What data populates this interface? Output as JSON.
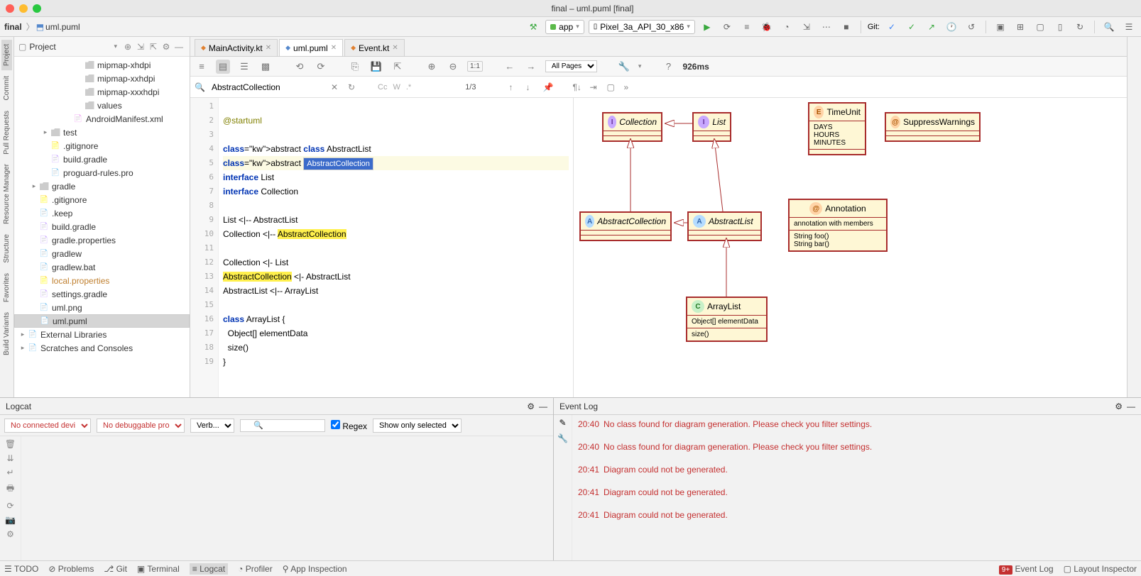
{
  "window": {
    "title": "final – uml.puml [final]"
  },
  "breadcrumb": {
    "proj": "final",
    "file": "uml.puml"
  },
  "run": {
    "app": "app",
    "device": "Pixel_3a_API_30_x86"
  },
  "git_label": "Git:",
  "project_panel": {
    "title": "Project"
  },
  "tree": {
    "items": [
      {
        "indent": 5,
        "tw": "",
        "ico": "folder",
        "label": "mipmap-xhdpi"
      },
      {
        "indent": 5,
        "tw": "",
        "ico": "folder",
        "label": "mipmap-xxhdpi"
      },
      {
        "indent": 5,
        "tw": "",
        "ico": "folder",
        "label": "mipmap-xxxhdpi"
      },
      {
        "indent": 5,
        "tw": "",
        "ico": "folder",
        "label": "values"
      },
      {
        "indent": 4,
        "tw": "",
        "ico": "mf",
        "label": "AndroidManifest.xml"
      },
      {
        "indent": 2,
        "tw": "▸",
        "ico": "folder",
        "label": "test"
      },
      {
        "indent": 2,
        "tw": "",
        "ico": "orange",
        "label": ".gitignore"
      },
      {
        "indent": 2,
        "tw": "",
        "ico": "green",
        "label": "build.gradle"
      },
      {
        "indent": 2,
        "tw": "",
        "ico": "blue",
        "label": "proguard-rules.pro"
      },
      {
        "indent": 1,
        "tw": "▸",
        "ico": "folder",
        "label": "gradle"
      },
      {
        "indent": 1,
        "tw": "",
        "ico": "orange",
        "label": ".gitignore"
      },
      {
        "indent": 1,
        "tw": "",
        "ico": "blue",
        "label": ".keep"
      },
      {
        "indent": 1,
        "tw": "",
        "ico": "green",
        "label": "build.gradle"
      },
      {
        "indent": 1,
        "tw": "",
        "ico": "green",
        "label": "gradle.properties"
      },
      {
        "indent": 1,
        "tw": "",
        "ico": "blue",
        "label": "gradlew"
      },
      {
        "indent": 1,
        "tw": "",
        "ico": "blue",
        "label": "gradlew.bat"
      },
      {
        "indent": 1,
        "tw": "",
        "ico": "orange",
        "label": "local.properties",
        "orange_text": true
      },
      {
        "indent": 1,
        "tw": "",
        "ico": "green",
        "label": "settings.gradle"
      },
      {
        "indent": 1,
        "tw": "",
        "ico": "blue",
        "label": "uml.png"
      },
      {
        "indent": 1,
        "tw": "",
        "ico": "blue",
        "label": "uml.puml",
        "sel": true
      },
      {
        "indent": 0,
        "tw": "▸",
        "ico": "lib",
        "label": "External Libraries"
      },
      {
        "indent": 0,
        "tw": "▸",
        "ico": "scratch",
        "label": "Scratches and Consoles"
      }
    ]
  },
  "tabs": [
    {
      "label": "MainActivity.kt",
      "ico": "kt"
    },
    {
      "label": "uml.puml",
      "ico": "puml",
      "active": true
    },
    {
      "label": "Event.kt",
      "ico": "kt"
    }
  ],
  "edit_toolbar": {
    "pages": "All Pages",
    "timing": "926ms"
  },
  "search": {
    "value": "AbstractCollection",
    "pages": "1/3",
    "cc": "Cc",
    "w": "W",
    "dot": ".*"
  },
  "code_lines": [
    "",
    "@startuml",
    "",
    "abstract class AbstractList",
    "abstract AbstractCollection",
    "interface List",
    "interface Collection",
    "",
    "List <|-- AbstractList",
    "Collection <|-- AbstractCollection",
    "",
    "Collection <|- List",
    "AbstractCollection <|- AbstractList",
    "AbstractList <|-- ArrayList",
    "",
    "class ArrayList {",
    "  Object[] elementData",
    "  size()",
    "}"
  ],
  "uml": {
    "Collection": "Collection",
    "List": "List",
    "AbstractCollection": "AbstractCollection",
    "AbstractList": "AbstractList",
    "ArrayList": "ArrayList",
    "ArrayList_f1": "Object[] elementData",
    "ArrayList_m1": "size()",
    "TimeUnit": "TimeUnit",
    "TimeUnit_b": "DAYS\nHOURS\nMINUTES",
    "SuppressWarnings": "SuppressWarnings",
    "Annotation": "Annotation",
    "Annotation_sub": "annotation with members",
    "Annotation_b": "String foo()\nString bar()"
  },
  "logcat": {
    "title": "Logcat",
    "device": "No connected devi",
    "process": "No debuggable pro",
    "level": "Verb...",
    "filter_placeholder": "",
    "regex": "Regex",
    "sel": "Show only selected"
  },
  "eventlog": {
    "title": "Event Log",
    "entries": [
      {
        "time": "20:40",
        "msg": "No class found for diagram generation. Please check you filter settings."
      },
      {
        "time": "20:40",
        "msg": "No class found for diagram generation. Please check you filter settings."
      },
      {
        "time": "20:41",
        "msg": "Diagram could not be generated."
      },
      {
        "time": "20:41",
        "msg": "Diagram could not be generated."
      },
      {
        "time": "20:41",
        "msg": "Diagram could not be generated."
      }
    ]
  },
  "status": {
    "todo": "TODO",
    "problems": "Problems",
    "git": "Git",
    "terminal": "Terminal",
    "logcat": "Logcat",
    "profiler": "Profiler",
    "appinsp": "App Inspection",
    "eventlog": "Event Log",
    "layoutinsp": "Layout Inspector"
  },
  "rails": {
    "project": "Project",
    "commit": "Commit",
    "pr": "Pull Requests",
    "rm": "Resource Manager",
    "structure": "Structure",
    "bv": "Build Variants",
    "fav": "Favorites"
  }
}
